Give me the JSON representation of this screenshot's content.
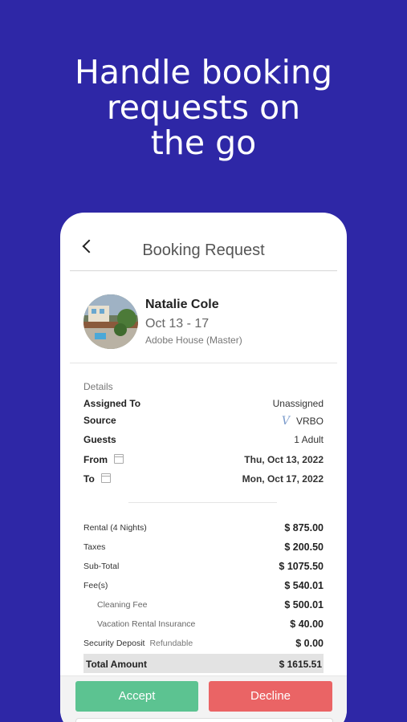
{
  "headline": {
    "line1": "Handle booking",
    "line2": "requests on",
    "line3": "the go"
  },
  "screen": {
    "title": "Booking Request",
    "guest": {
      "name": "Natalie Cole",
      "dates": "Oct 13 - 17",
      "property": "Adobe House (Master)"
    },
    "details": {
      "label": "Details",
      "rows": [
        {
          "label": "Assigned To",
          "value": "Unassigned"
        },
        {
          "label": "Source",
          "value": "VRBO",
          "logo": "V"
        },
        {
          "label": "Guests",
          "value": "1 Adult"
        },
        {
          "label": "From",
          "value": "Thu, Oct 13, 2022"
        },
        {
          "label": "To",
          "value": "Mon, Oct 17, 2022"
        }
      ]
    },
    "fees": {
      "rows": [
        {
          "label": "Rental (4 Nights)",
          "value": "$ 875.00"
        },
        {
          "label": "Taxes",
          "value": "$ 200.50"
        },
        {
          "label": "Sub-Total",
          "value": "$ 1075.50"
        },
        {
          "label": "Fee(s)",
          "value": "$ 540.01"
        },
        {
          "label": "Cleaning Fee",
          "value": "$ 500.01"
        },
        {
          "label": "Vacation Rental Insurance",
          "value": "$ 40.00"
        },
        {
          "label": "Security Deposit",
          "hint": "Refundable",
          "value": "$ 0.00"
        }
      ],
      "total": {
        "label": "Total Amount",
        "value": "$ 1615.51"
      }
    },
    "actions": {
      "accept": "Accept",
      "decline": "Decline"
    }
  },
  "colors": {
    "background": "#2e27a6",
    "accept": "#5cc391",
    "decline": "#ea6465",
    "vrbo_logo": "#7c9ccc"
  }
}
